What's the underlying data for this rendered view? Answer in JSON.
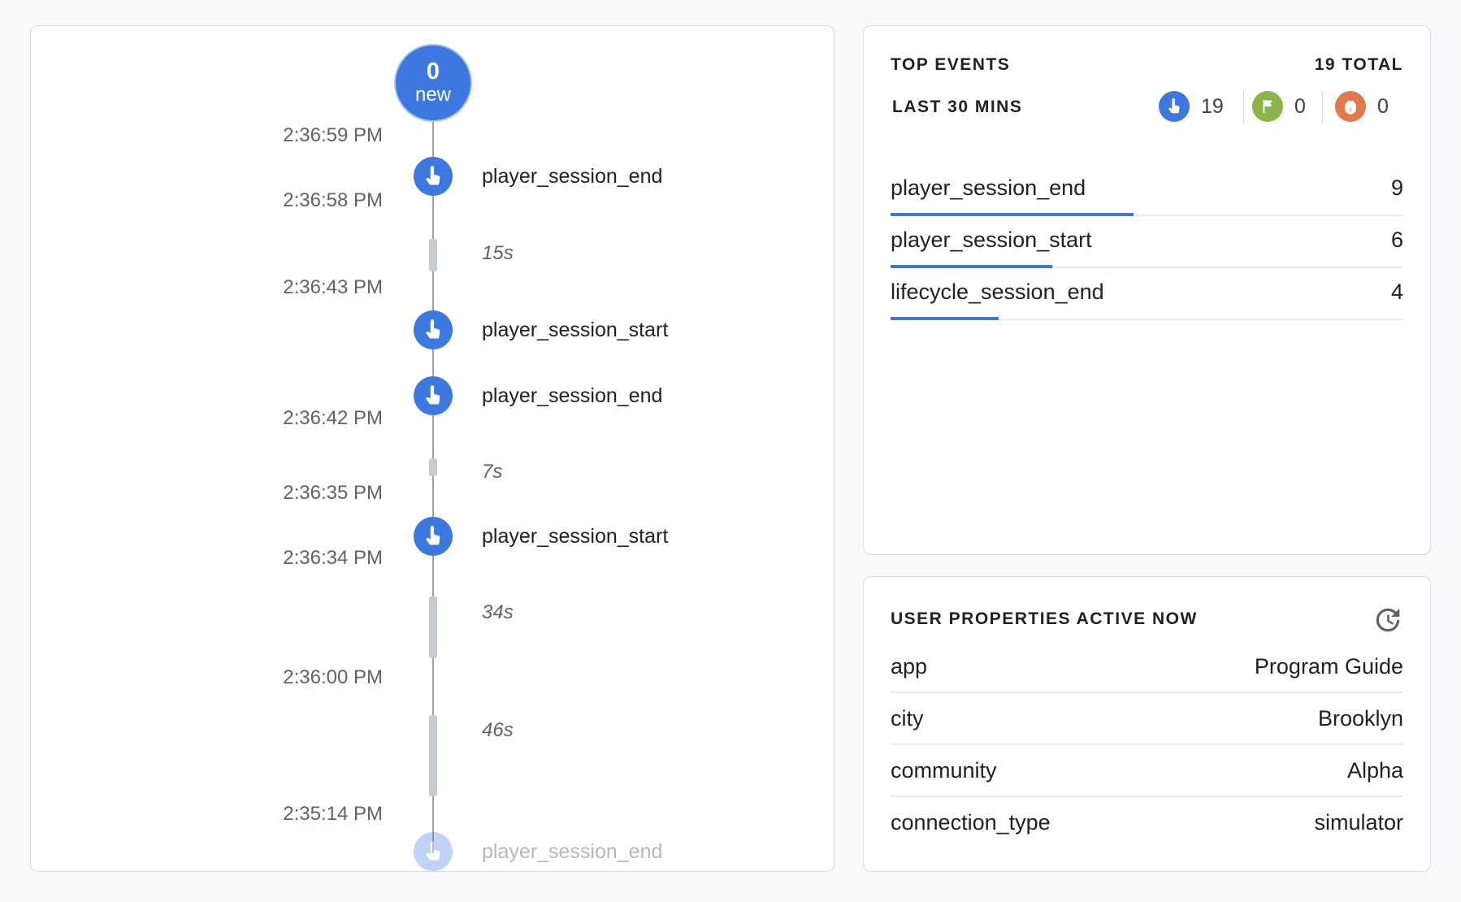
{
  "timeline": {
    "new_count": "0",
    "new_label": "new",
    "timestamps": [
      "2:36:59 PM",
      "2:36:58 PM",
      "2:36:43 PM",
      "2:36:42 PM",
      "2:36:35 PM",
      "2:36:34 PM",
      "2:36:00 PM",
      "2:35:14 PM"
    ],
    "events": [
      {
        "name": "player_session_end",
        "icon": "touch-icon"
      },
      {
        "name": "player_session_start",
        "icon": "touch-icon"
      },
      {
        "name": "player_session_end",
        "icon": "touch-icon"
      },
      {
        "name": "player_session_start",
        "icon": "touch-icon"
      },
      {
        "name": "player_session_end",
        "icon": "touch-icon"
      }
    ],
    "durations": [
      "15s",
      "7s",
      "34s",
      "46s"
    ]
  },
  "top_events": {
    "title": "TOP EVENTS",
    "total_label": "19 TOTAL",
    "period_label": "LAST 30 MINS",
    "stats": [
      {
        "icon": "touch-icon",
        "value": "19",
        "color": "#3c78e0"
      },
      {
        "icon": "flag-icon",
        "value": "0",
        "color": "#8ab548"
      },
      {
        "icon": "bug-icon",
        "value": "0",
        "color": "#e07a4d"
      }
    ],
    "rows": [
      {
        "name": "player_session_end",
        "count": "9",
        "fraction": 0.474
      },
      {
        "name": "player_session_start",
        "count": "6",
        "fraction": 0.316
      },
      {
        "name": "lifecycle_session_end",
        "count": "4",
        "fraction": 0.211
      }
    ]
  },
  "user_properties": {
    "title": "USER PROPERTIES ACTIVE NOW",
    "rows": [
      {
        "key": "app",
        "value": "Program Guide"
      },
      {
        "key": "city",
        "value": "Brooklyn"
      },
      {
        "key": "community",
        "value": "Alpha"
      },
      {
        "key": "connection_type",
        "value": "simulator"
      }
    ]
  },
  "colors": {
    "accent": "#3c78e0",
    "flag": "#8ab548",
    "bug": "#e07a4d"
  }
}
